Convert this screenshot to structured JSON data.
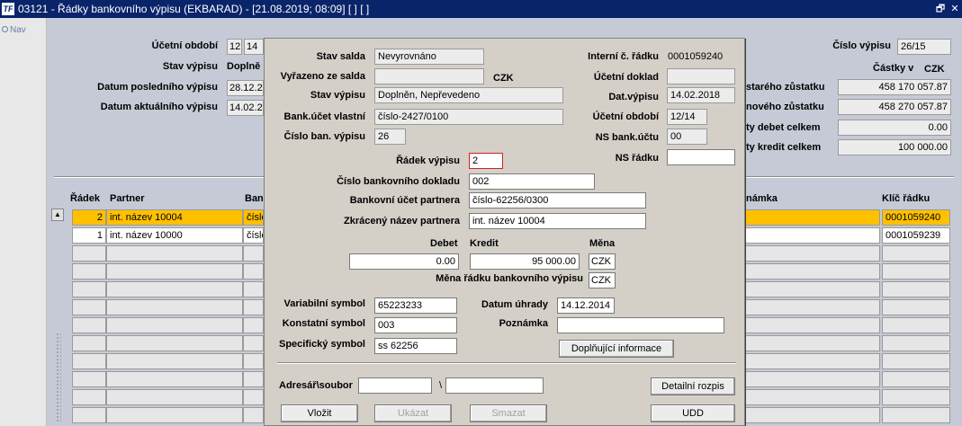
{
  "window": {
    "title": "03121 - Řádky bankovního výpisu (EKBARAD) - [21.08.2019; 08:09]  [ ]  [ ]",
    "app_icon": "TF",
    "restore_glyph": "🗗",
    "close_glyph": "✕"
  },
  "sidebar": {
    "nav_label": "Nav"
  },
  "header": {
    "ucetni_obdobi_label": "Účetní období",
    "ucetni_obdobi_1": "12",
    "ucetni_obdobi_2": "14",
    "stav_vypisu_label": "Stav výpisu",
    "stav_vypisu_value": "Doplně",
    "datum_posledniho_label": "Datum posledního výpisu",
    "datum_posledniho_value": "28.12.2",
    "datum_aktualniho_label": "Datum aktuálního výpisu",
    "datum_aktualniho_value": "14.02.2",
    "cislo_vypisu_label": "Číslo výpisu",
    "cislo_vypisu_value": "26/15",
    "castky_v_label": "Částky v",
    "castky_v_currency": "CZK",
    "stareho_label": "starého zůstatku",
    "stareho_value": "458 170 057.87",
    "noveho_label": "nového zůstatku",
    "noveho_value": "458 270 057.87",
    "debet_celkem_label": "ty debet celkem",
    "debet_celkem_value": "0.00",
    "kredit_celkem_label": "ty kredit celkem",
    "kredit_celkem_value": "100 000.00"
  },
  "table": {
    "col_radek": "Řádek",
    "col_partner": "Partner",
    "col_ban": "Ban",
    "col_poznamka": "námka",
    "col_klic": "Klíč řádku",
    "rows": [
      {
        "radek": "2",
        "partner": "int. název 10004",
        "ban": "číslo",
        "klic": "0001059240"
      },
      {
        "radek": "1",
        "partner": "int. název 10000",
        "ban": "číslo",
        "klic": "0001059239"
      }
    ]
  },
  "dialog": {
    "stav_salda_label": "Stav salda",
    "stav_salda_value": "Nevyrovnáno",
    "vyrazeno_label": "Vyřazeno ze salda",
    "vyrazeno_value": "",
    "vyrazeno_currency": "CZK",
    "stav_vypisu_label": "Stav výpisu",
    "stav_vypisu_value": "Doplněn, Nepřevedeno",
    "bank_ucet_label": "Bank.účet vlastní",
    "bank_ucet_value": "číslo-2427/0100",
    "cislo_ban_label": "Číslo ban. výpisu",
    "cislo_ban_value": "26",
    "interni_label": "Interní č. řádku",
    "interni_value": "0001059240",
    "ucetni_doklad_label": "Účetní doklad",
    "ucetni_doklad_value": "",
    "dat_vypisu_label": "Dat.výpisu",
    "dat_vypisu_value": "14.02.2018",
    "ucetni_obdobi_label": "Účetní období",
    "ucetni_obdobi_value": "12/14",
    "ns_bank_label": "NS bank.účtu",
    "ns_bank_value": "00",
    "ns_radku_label": "NS řádku",
    "ns_radku_value": "",
    "radek_vypisu_label": "Řádek výpisu",
    "radek_vypisu_value": "2",
    "cislo_dokladu_label": "Číslo bankovního dokladu",
    "cislo_dokladu_value": "002",
    "bankovni_ucet_partnera_label": "Bankovní účet partnera",
    "bankovni_ucet_partnera_value": "číslo-62256/0300",
    "zkraceny_nazev_label": "Zkrácený název partnera",
    "zkraceny_nazev_value": "int. název 10004",
    "debet_label": "Debet",
    "kredit_label": "Kredit",
    "mena_label": "Měna",
    "debet_value": "0.00",
    "kredit_value": "95 000.00",
    "mena_value": "CZK",
    "mena_radku_label": "Měna řádku bankovního výpisu",
    "mena_radku_value": "CZK",
    "variabilni_label": "Variabilní symbol",
    "variabilni_value": "65223233",
    "konstantni_label": "Konstatní symbol",
    "konstantni_value": "003",
    "specificky_label": "Specifický symbol",
    "specificky_value": "ss 62256",
    "datum_uhrady_label": "Datum úhrady",
    "datum_uhrady_value": "14.12.2014",
    "poznamka_label": "Poznámka",
    "poznamka_value": "",
    "doplnujici_button": "Doplňující informace",
    "adresar_label": "Adresář\\soubor",
    "adresar_value": "",
    "soubor_sep": "\\",
    "soubor_value": "",
    "detailni_button": "Detailní rozpis",
    "vlozit_button": "Vložit",
    "ukazat_button": "Ukázat",
    "smazat_button": "Smazat",
    "udd_button": "UDD"
  }
}
